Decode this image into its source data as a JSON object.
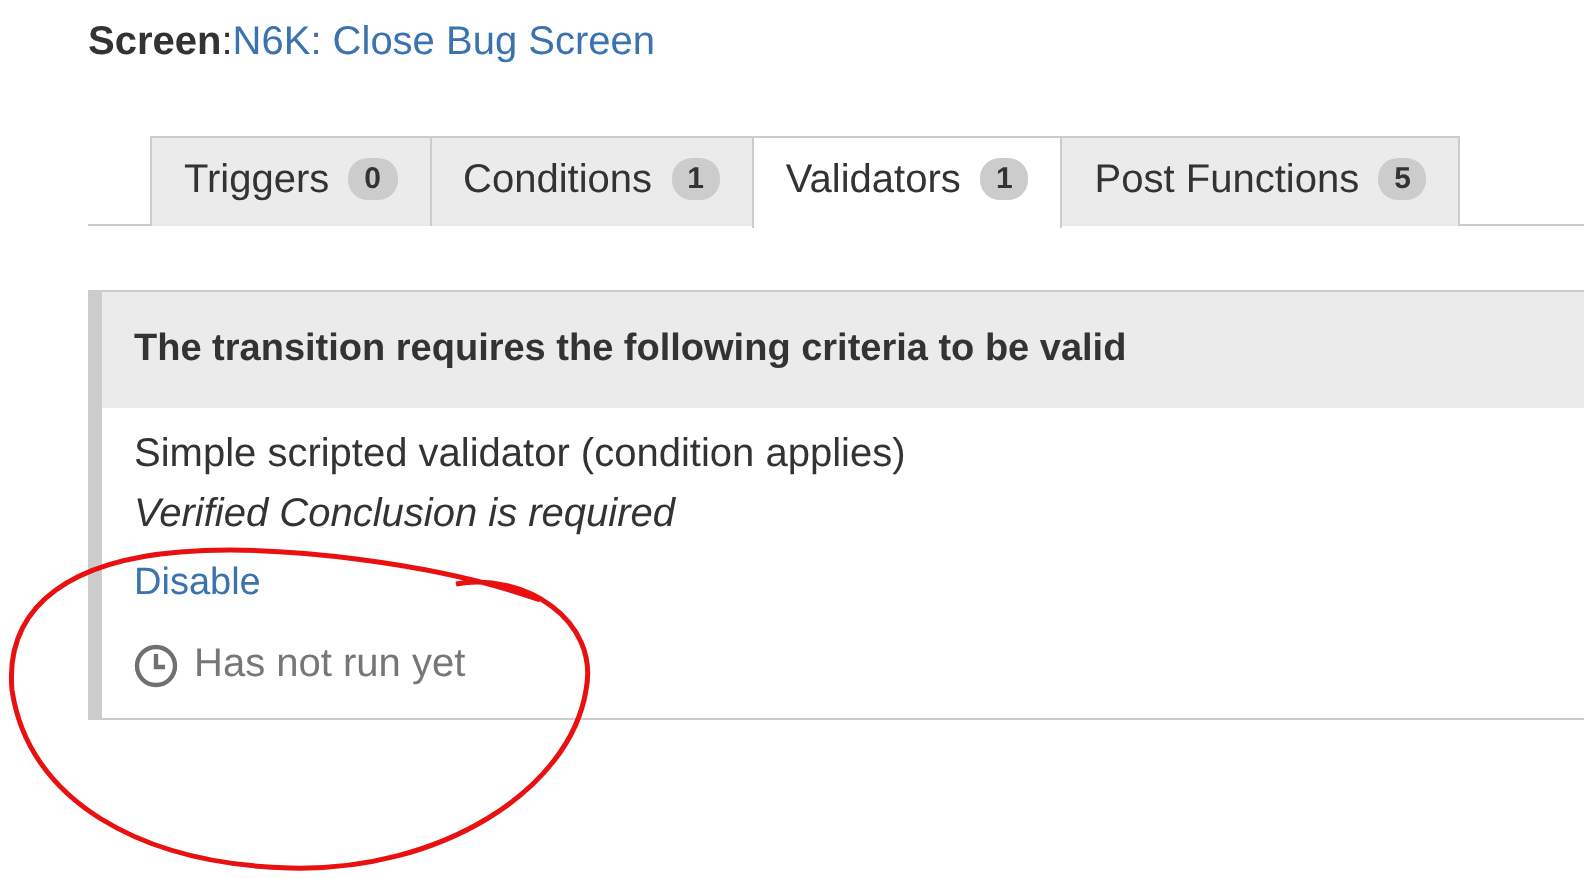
{
  "screen": {
    "label": "**Screen**:",
    "name": "N6K: Close Bug Screen"
  },
  "tabs": [
    {
      "label": "Triggers",
      "count": "0",
      "selected": false
    },
    {
      "label": "Conditions",
      "count": "1",
      "selected": false
    },
    {
      "label": "Validators",
      "count": "1",
      "selected": true
    },
    {
      "label": "Post Functions",
      "count": "5",
      "selected": false
    }
  ],
  "panel": {
    "heading": "The transition requires the following criteria to be valid",
    "title": "Simple scripted validator (condition applies)",
    "description": "Verified Conclusion is required",
    "action": "Disable",
    "status": "Has not run yet"
  }
}
